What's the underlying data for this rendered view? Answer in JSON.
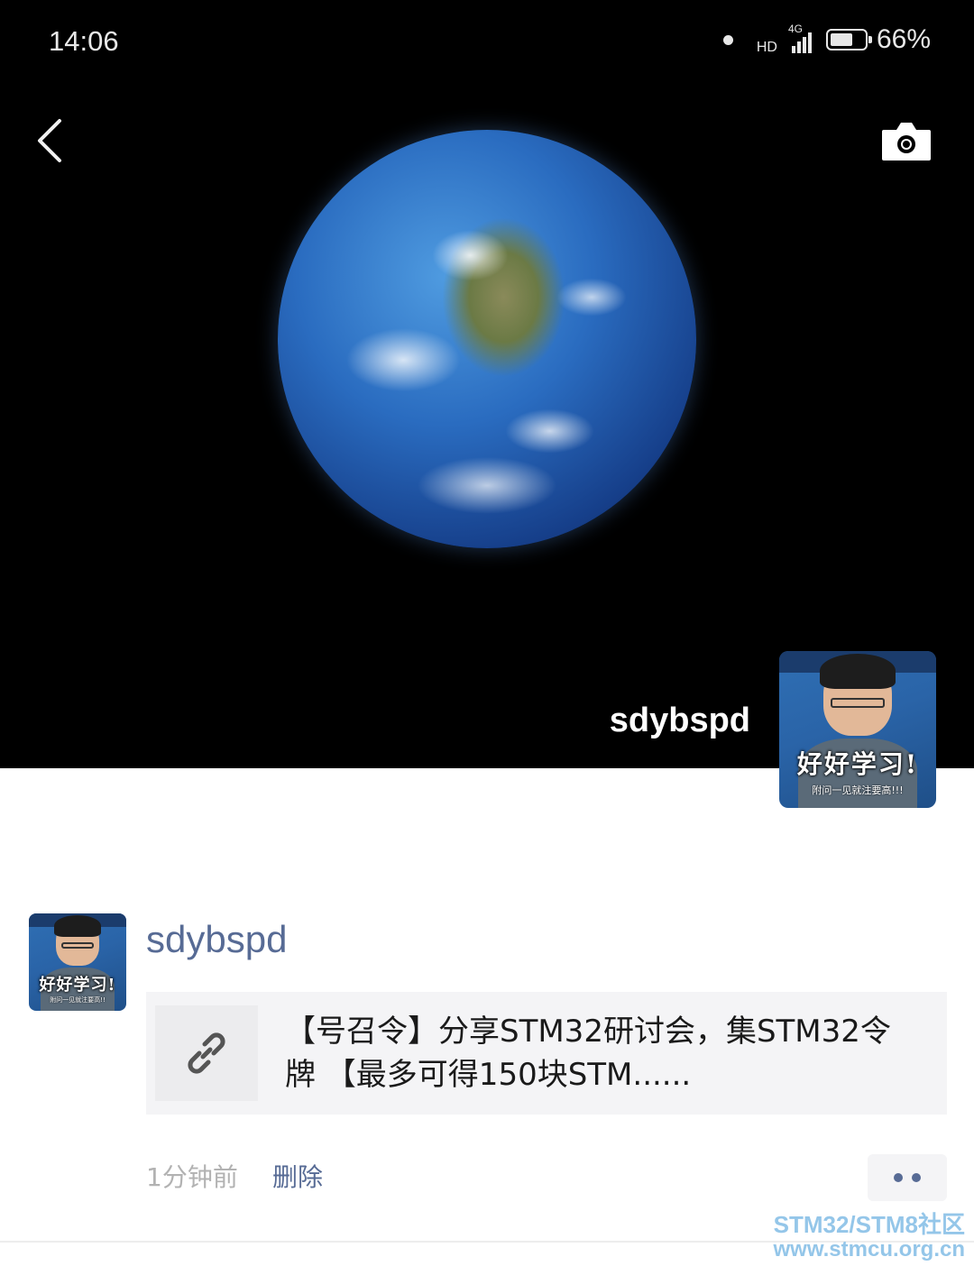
{
  "status_bar": {
    "time": "14:06",
    "hd": "HD",
    "network": "4G",
    "battery_percent": "66%",
    "battery_level": 0.66
  },
  "header": {
    "back_icon": "chevron-left-icon",
    "camera_icon": "camera-icon"
  },
  "cover": {
    "image": "earth-from-space",
    "username": "sdybspd",
    "avatar": {
      "caption": "好好学习!",
      "subcaption": "附问一见就注要高!!!"
    }
  },
  "post": {
    "username": "sdybspd",
    "avatar": {
      "caption": "好好学习!",
      "subcaption": "附问一见就注要高!!"
    },
    "link": {
      "icon": "link-icon",
      "title": "【号召令】分享STM32研讨会，集STM32令牌 【最多可得150块STM......"
    },
    "time": "1分钟前",
    "delete_label": "删除",
    "more_icon": "more-dots-icon"
  },
  "watermark": {
    "line1": "STM32/STM8社区",
    "line2": "www.stmcu.org.cn"
  },
  "colors": {
    "link_blue": "#576b95",
    "card_bg": "#f4f4f6",
    "meta_gray": "#b2b2b2",
    "watermark": "#8fc3e8"
  }
}
